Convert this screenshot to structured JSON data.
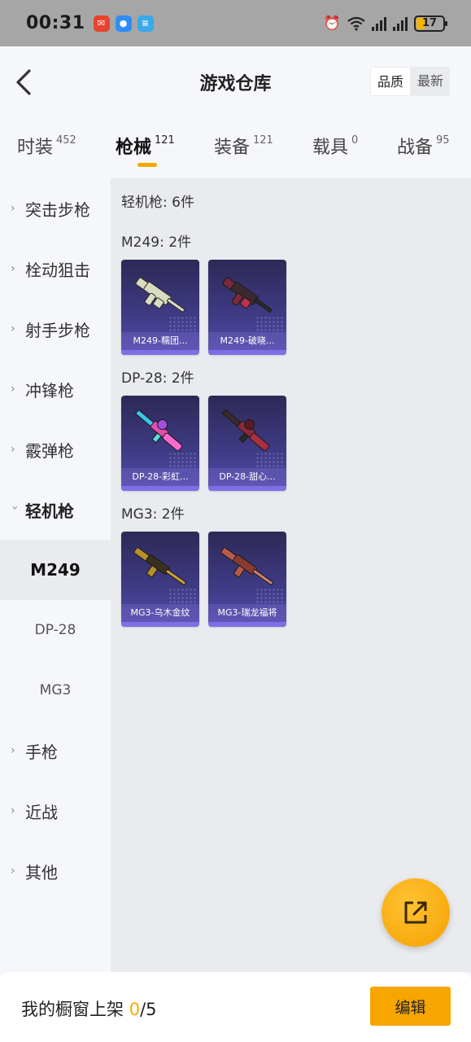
{
  "status_bar": {
    "time": "00:31",
    "battery": "17"
  },
  "header": {
    "title": "游戏仓库",
    "sort_quality": "品质",
    "sort_newest": "最新"
  },
  "tabs": [
    {
      "label": "时装",
      "count": "452"
    },
    {
      "label": "枪械",
      "count": "121"
    },
    {
      "label": "装备",
      "count": "121"
    },
    {
      "label": "载具",
      "count": "0"
    },
    {
      "label": "战备",
      "count": "95"
    }
  ],
  "sidebar": {
    "categories": [
      {
        "label": "突击步枪"
      },
      {
        "label": "栓动狙击"
      },
      {
        "label": "射手步枪"
      },
      {
        "label": "冲锋枪"
      },
      {
        "label": "霰弹枪"
      },
      {
        "label": "轻机枪"
      },
      {
        "label": "手枪"
      },
      {
        "label": "近战"
      },
      {
        "label": "其他"
      }
    ],
    "subcategories": [
      "M249",
      "DP-28",
      "MG3"
    ]
  },
  "content": {
    "total": "轻机枪: 6件",
    "groups": [
      {
        "title": "M249: 2件",
        "items": [
          {
            "name": "M249-糯团..."
          },
          {
            "name": "M249-破晓..."
          }
        ]
      },
      {
        "title": "DP-28: 2件",
        "items": [
          {
            "name": "DP-28-彩虹..."
          },
          {
            "name": "DP-28-甜心..."
          }
        ]
      },
      {
        "title": "MG3: 2件",
        "items": [
          {
            "name": "MG3-乌木金纹"
          },
          {
            "name": "MG3-瑞龙福将"
          }
        ]
      }
    ]
  },
  "bottom": {
    "shelf_label": "我的橱窗上架 ",
    "shelf_current": "0",
    "shelf_total": "/5",
    "edit_label": "编辑"
  },
  "colors": {
    "accent": "#f7a500",
    "card_top": "#2d2956",
    "card_bottom": "#554cb0",
    "weapon_m249_1": "#d9dcc0",
    "weapon_m249_2": "#7a2a3a",
    "weapon_dp28_1": "#e04fb0",
    "weapon_dp28_2": "#8a2a38",
    "weapon_mg3_1": "#b8902a",
    "weapon_mg3_2": "#b85a4a"
  }
}
